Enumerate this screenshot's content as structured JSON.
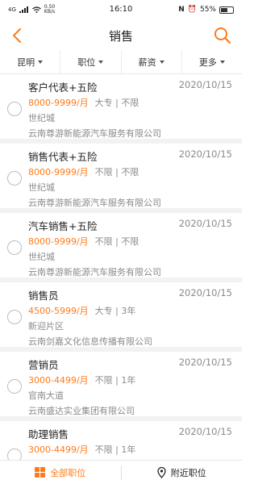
{
  "status_bar": {
    "signal": "4G",
    "speed": "0.50 KB/s",
    "time": "16:10",
    "battery": "55%",
    "battery_level": 0.55
  },
  "nav": {
    "title": "销售",
    "back_icon": "chevron-left-icon",
    "search_icon": "search-icon",
    "accent": "#ff7a1a"
  },
  "filters": [
    {
      "label": "昆明"
    },
    {
      "label": "职位"
    },
    {
      "label": "薪资"
    },
    {
      "label": "更多"
    }
  ],
  "jobs": [
    {
      "title": "客户代表+五险",
      "date": "2020/10/15",
      "salary": "8000-9999/月",
      "requirements": "大专 | 不限",
      "location": "世纪城",
      "company": "云南尊游新能源汽车服务有限公司"
    },
    {
      "title": "销售代表+五险",
      "date": "2020/10/15",
      "salary": "8000-9999/月",
      "requirements": "不限 | 不限",
      "location": "世纪城",
      "company": "云南尊游新能源汽车服务有限公司"
    },
    {
      "title": "汽车销售+五险",
      "date": "2020/10/15",
      "salary": "8000-9999/月",
      "requirements": "不限 | 不限",
      "location": "世纪城",
      "company": "云南尊游新能源汽车服务有限公司"
    },
    {
      "title": "销售员",
      "date": "2020/10/15",
      "salary": "4500-5999/月",
      "requirements": "大专 | 3年",
      "location": "新迎片区",
      "company": "云南剑嘉文化信息传播有限公司"
    },
    {
      "title": "营销员",
      "date": "2020/10/15",
      "salary": "3000-4499/月",
      "requirements": "不限 | 1年",
      "location": "官南大道",
      "company": "云南盛达实业集团有限公司"
    },
    {
      "title": "助理销售",
      "date": "2020/10/15",
      "salary": "3000-4499/月",
      "requirements": "不限 | 1年",
      "location": "",
      "company": ""
    }
  ],
  "bottom_bar": {
    "all_jobs": "全部职位",
    "nearby_jobs": "附近职位"
  }
}
